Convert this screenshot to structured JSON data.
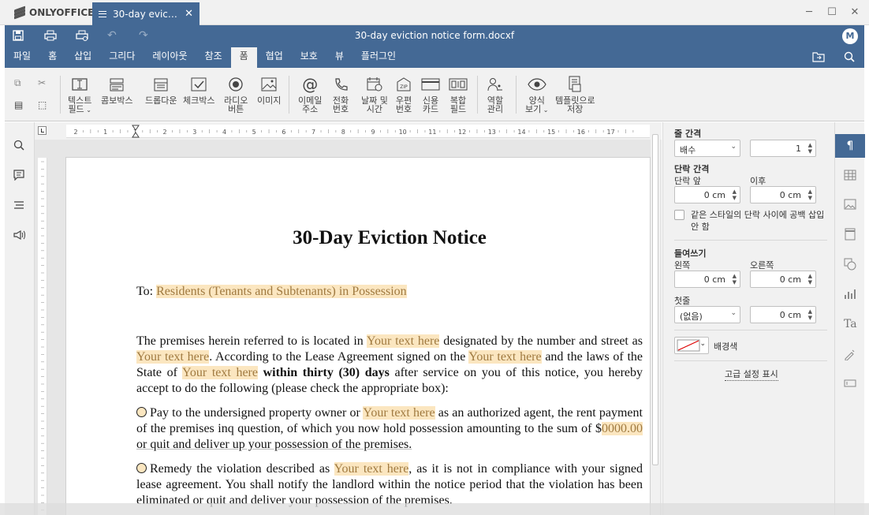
{
  "app": {
    "brand": "ONLYOFFICE"
  },
  "tab": {
    "title": "30-day evictio…",
    "close": "✕"
  },
  "window": {
    "minimize": "─",
    "maximize": "☐",
    "close": "✕"
  },
  "header": {
    "doc_title": "30-day eviction notice form.docxf",
    "avatar": "M",
    "menu": [
      "파일",
      "홈",
      "삽입",
      "그리다",
      "레이아웃",
      "참조",
      "폼",
      "협업",
      "보호",
      "뷰",
      "플러그인"
    ],
    "active_menu": "폼"
  },
  "toolbar": {
    "text_field": [
      "텍스트",
      "필드"
    ],
    "combo_box": "콤보박스",
    "dropdown": "드롭다운",
    "checkbox": "체크박스",
    "radio": [
      "라디오",
      "버튼"
    ],
    "image": "이미지",
    "email": [
      "이메일",
      "주소"
    ],
    "phone": [
      "전화",
      "번호"
    ],
    "datetime": [
      "날짜 및",
      "시간"
    ],
    "zip": [
      "우편",
      "번호"
    ],
    "credit": [
      "신용",
      "카드"
    ],
    "complex": [
      "복합",
      "필드"
    ],
    "roles": [
      "역할",
      "관리"
    ],
    "view_form": [
      "양식",
      "보기"
    ],
    "save_template": [
      "템플릿으로",
      "저장"
    ],
    "zip_label": "ZIP"
  },
  "ruler": {
    "h_numbers": [
      "2",
      "1",
      "1",
      "2",
      "3",
      "4",
      "5",
      "6",
      "7",
      "8",
      "9",
      "10",
      "11",
      "12",
      "13",
      "14",
      "15",
      "16",
      "17"
    ]
  },
  "document": {
    "title": "30-Day Eviction Notice",
    "to_label": "To:",
    "to_field": "Residents (Tenants and Subtenants) in Possession",
    "p1_a": "The premises herein referred to is located in ",
    "field": "Your text here",
    "p1_b": " designated by the number and street as ",
    "p1_c": ". According to the Lease Agreement signed on the ",
    "p1_d": " and the laws of the State of ",
    "p1_bold": " within thirty (30) days",
    "p1_e": " after service on you of this notice, you hereby accept to do the following (please check the appropriate box):",
    "p2_a": "Pay to the undersigned property owner or ",
    "p2_b": " as an authorized agent, the rent payment of the premises inq question, of which you now hold possession amounting to the sum of $",
    "amount": "0000.00",
    "p2_c": " or quit and deliver up your possession of the premises.",
    "p3_a": "Remedy the violation described as ",
    "p3_b": ", as it is not in compliance with your signed lease agreement. You shall notify the landlord within the notice period that the violation has been eliminated or quit and deliver your possession of the premises."
  },
  "panel": {
    "line_spacing": "줄 간격",
    "line_mode": "배수",
    "line_value": "1",
    "para_spacing": "단락 간격",
    "before": "단락 앞",
    "after": "이후",
    "before_val": "0 cm",
    "after_val": "0 cm",
    "no_space": "같은 스타일의 단락 사이에 공백 삽입 안 함",
    "indent": "들여쓰기",
    "left": "왼쪽",
    "right": "오른쪽",
    "left_val": "0 cm",
    "right_val": "0 cm",
    "first": "첫줄",
    "first_mode": "(없음)",
    "first_val": "0 cm",
    "bg_color": "배경색",
    "advanced": "고급 설정 표시"
  },
  "colors": {
    "accent": "#446995",
    "field_bg": "#fbe6c0",
    "toolbar_bg": "#f1f1f1"
  }
}
